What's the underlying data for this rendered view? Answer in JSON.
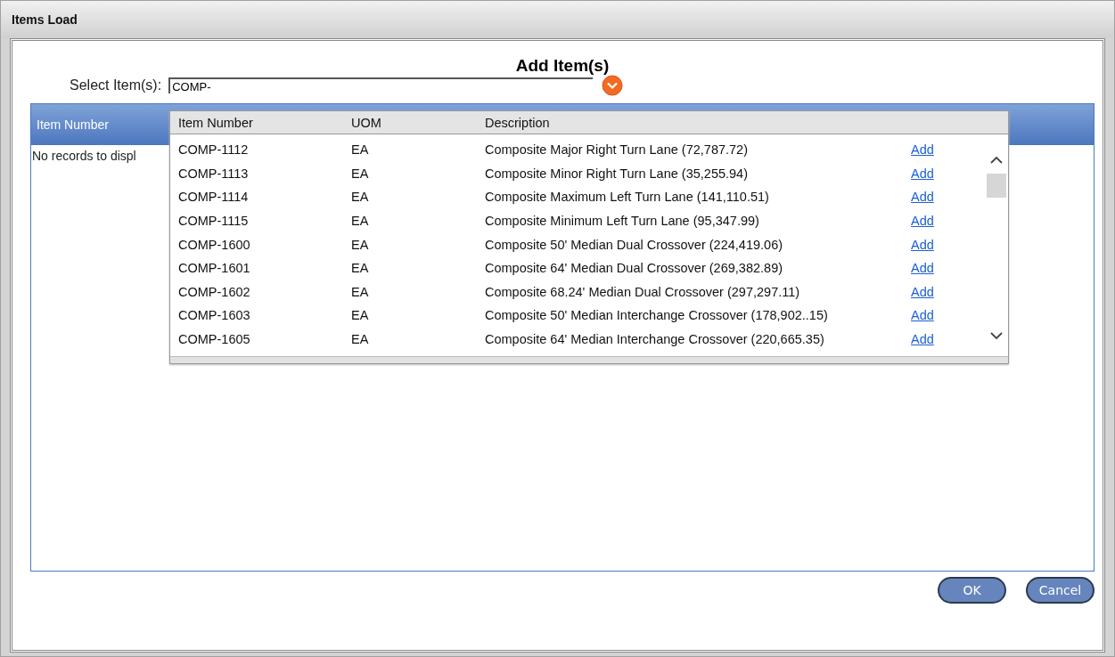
{
  "window": {
    "title": "Items Load"
  },
  "heading": "Add Item(s)",
  "select": {
    "label": "Select Item(s):",
    "value": "COMP-"
  },
  "grid": {
    "columns": [
      "Item Number"
    ],
    "empty_message": "No records to displ"
  },
  "dropdown": {
    "columns": [
      "Item Number",
      "UOM",
      "Description"
    ],
    "rows": [
      {
        "item_number": "COMP-1112",
        "uom": "EA",
        "description": "Composite Major Right Turn Lane (72,787.72)",
        "link": "Add"
      },
      {
        "item_number": "COMP-1113",
        "uom": "EA",
        "description": "Composite Minor Right Turn Lane (35,255.94)",
        "link": "Add"
      },
      {
        "item_number": "COMP-1114",
        "uom": "EA",
        "description": "Composite Maximum Left Turn Lane (141,110.51)",
        "link": "Add"
      },
      {
        "item_number": "COMP-1115",
        "uom": "EA",
        "description": "Composite Minimum Left Turn Lane (95,347.99)",
        "link": "Add"
      },
      {
        "item_number": "COMP-1600",
        "uom": "EA",
        "description": "Composite 50' Median Dual Crossover (224,419.06)",
        "link": "Add"
      },
      {
        "item_number": "COMP-1601",
        "uom": "EA",
        "description": "Composite 64' Median Dual Crossover (269,382.89)",
        "link": "Add"
      },
      {
        "item_number": "COMP-1602",
        "uom": "EA",
        "description": "Composite 68.24' Median Dual Crossover (297,297.11)",
        "link": "Add"
      },
      {
        "item_number": "COMP-1603",
        "uom": "EA",
        "description": "Composite 50' Median Interchange Crossover (178,902..15)",
        "link": "Add"
      },
      {
        "item_number": "COMP-1605",
        "uom": "EA",
        "description": "Composite 64' Median Interchange Crossover (220,665.35)",
        "link": "Add"
      }
    ]
  },
  "buttons": [
    "OK",
    "Cancel"
  ]
}
